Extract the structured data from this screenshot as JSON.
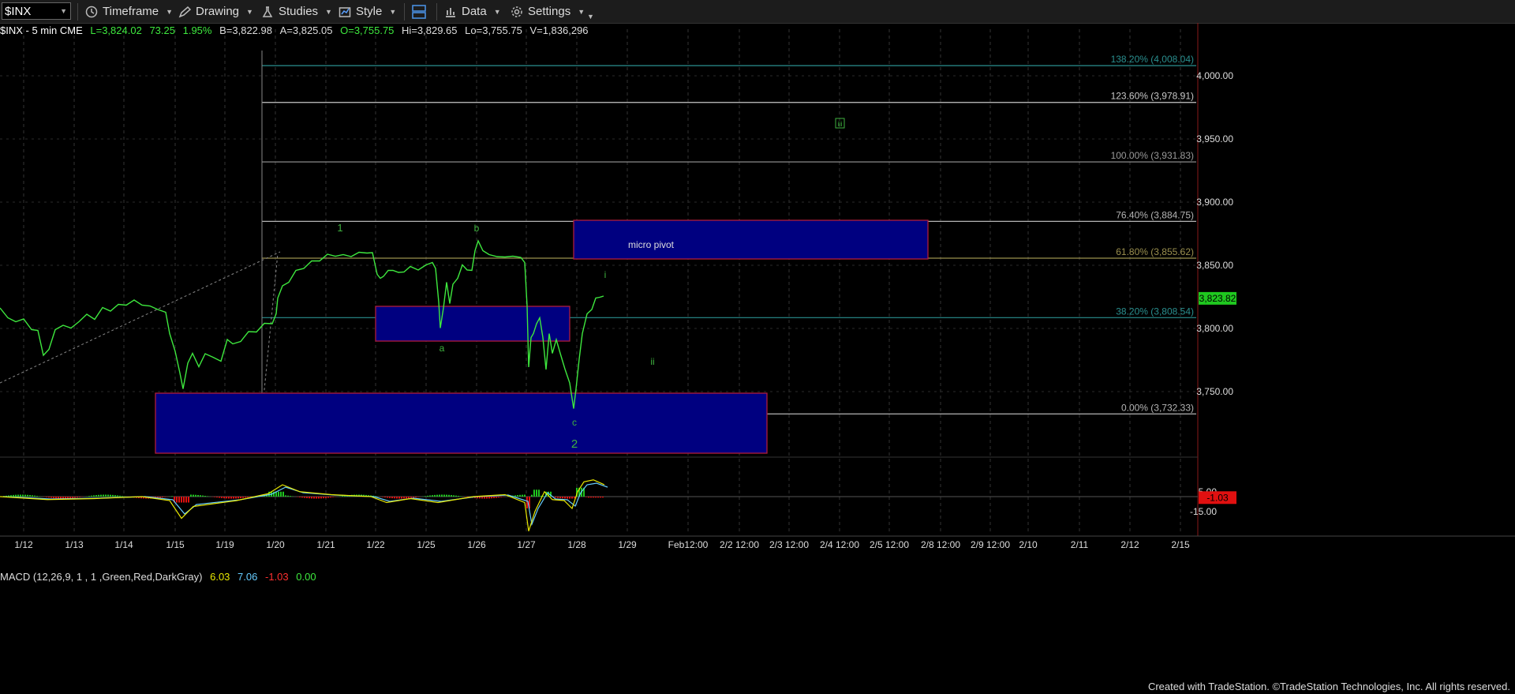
{
  "toolbar": {
    "symbol": "$INX",
    "timeframe": "Timeframe",
    "drawing": "Drawing",
    "studies": "Studies",
    "style": "Style",
    "data": "Data",
    "settings": "Settings"
  },
  "info": {
    "symbol_desc": "$INX - 5 min  CME",
    "last": "L=3,824.02",
    "change": "73.25",
    "pct": "1.95%",
    "bid": "B=3,822.98",
    "ask": "A=3,825.05",
    "open": "O=3,755.75",
    "high": "Hi=3,829.65",
    "low": "Lo=3,755.75",
    "volume": "V=1,836,296"
  },
  "price_axis": {
    "ticks": [
      {
        "v": 4000,
        "label": "4,000.00"
      },
      {
        "v": 3950,
        "label": "3,950.00"
      },
      {
        "v": 3900,
        "label": "3,900.00"
      },
      {
        "v": 3850,
        "label": "3,850.00"
      },
      {
        "v": 3800,
        "label": "3,800.00"
      },
      {
        "v": 3750,
        "label": "3,750.00"
      }
    ],
    "current_price": "3,823.82"
  },
  "fib_levels": [
    {
      "label": "138.20% (4,008.04)",
      "price": 4008.04,
      "color": "#2a8f8f"
    },
    {
      "label": "123.60% (3,978.91)",
      "price": 3978.91,
      "color": "#c8c8c8"
    },
    {
      "label": "100.00% (3,931.83)",
      "price": 3931.83,
      "color": "#9a9a9a"
    },
    {
      "label": "76.40% (3,884.75)",
      "price": 3884.75,
      "color": "#b4b4b4"
    },
    {
      "label": "61.80% (3,855.62)",
      "price": 3855.62,
      "color": "#9a8f4e"
    },
    {
      "label": "38.20% (3,808.54)",
      "price": 3808.54,
      "color": "#2a8f8f"
    },
    {
      "label": "0.00% (3,732.33)",
      "price": 3732.33,
      "color": "#b4b4b4"
    }
  ],
  "annotations": {
    "micro_pivot": "micro pivot",
    "wave_1": "1",
    "wave_a": "a",
    "wave_b": "b",
    "wave_c": "c",
    "wave_2": "2",
    "wave_i": "i",
    "wave_ii": "ii",
    "wave_iii": "iii"
  },
  "x_axis": {
    "ticks": [
      "1/12",
      "1/13",
      "1/14",
      "1/15",
      "1/19",
      "1/20",
      "1/21",
      "1/22",
      "1/25",
      "1/26",
      "1/27",
      "1/28",
      "1/29",
      "Feb12:00",
      "2/2 12:00",
      "2/3 12:00",
      "2/4 12:00",
      "2/5 12:00",
      "2/8 12:00",
      "2/9 12:00",
      "2/10",
      "2/11",
      "2/12",
      "2/15"
    ]
  },
  "macd": {
    "label": "MACD (12,26,9, 1 , 1 ,Green,Red,DarkGray)",
    "macd_val": "6.03",
    "signal_val": "7.06",
    "hist_val": "-1.03",
    "zero_val": "0.00",
    "axis": [
      {
        "v": 5,
        "label": "5.00"
      },
      {
        "v": -15,
        "label": "-15.00"
      }
    ],
    "current": "-1.03"
  },
  "footer": "Created with TradeStation. ©TradeStation Technologies, Inc. All rights reserved.",
  "colors": {
    "price": "#3ee83e",
    "box_fill": "#000080",
    "box_border": "#b01c3c",
    "wave_label": "#3fb23f"
  }
}
